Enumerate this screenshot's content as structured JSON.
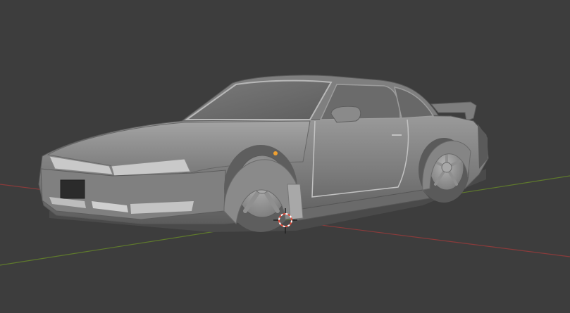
{
  "viewport": {
    "background_color": "#3d3d3d",
    "axis_colors": {
      "x": "#8a3b3b",
      "y": "#5f7a2c"
    },
    "model_color": "#8c8c8c"
  },
  "icons": {
    "cursor": "3d-cursor-icon",
    "origin": "object-origin-icon"
  },
  "colors": {
    "cursor_ring": "#e04a3a",
    "origin_dot": "#f0a030"
  }
}
